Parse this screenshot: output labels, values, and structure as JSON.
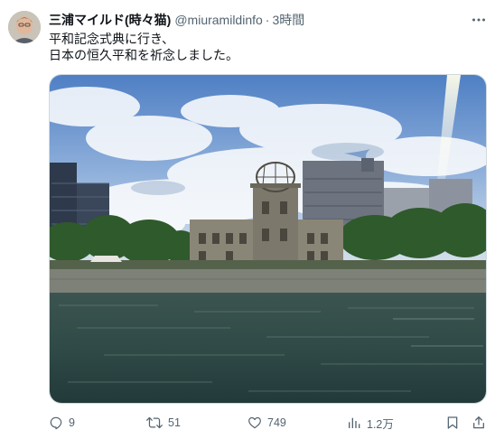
{
  "author": {
    "display_name": "三浦マイルド(時々猫)",
    "handle": "@miuramildinfo",
    "separator": "·",
    "time": "3時間"
  },
  "post": {
    "lines": [
      "平和記念式典に行き、",
      "日本の恒久平和を祈念しました。"
    ]
  },
  "media": {
    "alt": "Photo of the Atomic Bomb Dome across the river in Hiroshima under a partly cloudy sky"
  },
  "actions": {
    "replies": "9",
    "reposts": "51",
    "likes": "749",
    "views": "1.2万"
  },
  "colors": {
    "text": "#0f1419",
    "secondary": "#536471",
    "border": "#cfd9de"
  },
  "icons": [
    "avatar",
    "more-icon",
    "reply-icon",
    "repost-icon",
    "like-icon",
    "views-icon",
    "bookmark-icon",
    "share-icon"
  ]
}
